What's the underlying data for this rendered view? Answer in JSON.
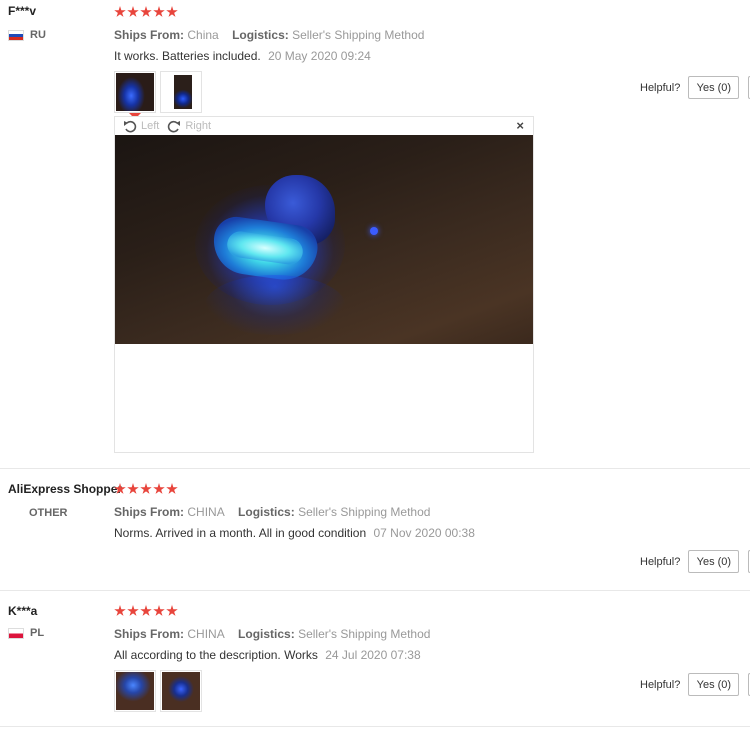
{
  "reviews": [
    {
      "user": "F***v",
      "country": "RU",
      "stars": 5,
      "ships_from_label": "Ships From:",
      "ships_from": "China",
      "logistics_label": "Logistics:",
      "logistics": "Seller's Shipping Method",
      "text": "It works. Batteries included.",
      "date": "20 May 2020 09:24",
      "photos": [
        "review-photo-1",
        "review-photo-2"
      ],
      "helpful_label": "Helpful?",
      "yes_label": "Yes (0)"
    },
    {
      "user": "AliExpress Shopper",
      "country": "OTHER",
      "stars": 5,
      "ships_from_label": "Ships From:",
      "ships_from": "CHINA",
      "logistics_label": "Logistics:",
      "logistics": "Seller's Shipping Method",
      "text": "Norms. Arrived in a month. All in good condition",
      "date": "07 Nov 2020 00:38",
      "helpful_label": "Helpful?",
      "yes_label": "Yes (0)"
    },
    {
      "user": "K***a",
      "country": "PL",
      "stars": 5,
      "ships_from_label": "Ships From:",
      "ships_from": "CHINA",
      "logistics_label": "Logistics:",
      "logistics": "Seller's Shipping Method",
      "text": "All according to the description. Works",
      "date": "24 Jul 2020 07:38",
      "photos": [
        "review-photo-1",
        "review-photo-2"
      ],
      "helpful_label": "Helpful?",
      "yes_label": "Yes (0)"
    }
  ],
  "viewer": {
    "rotate_left": "Left",
    "rotate_right": "Right",
    "close": "×"
  },
  "colors": {
    "star": "#e8453c",
    "muted": "#999999"
  }
}
